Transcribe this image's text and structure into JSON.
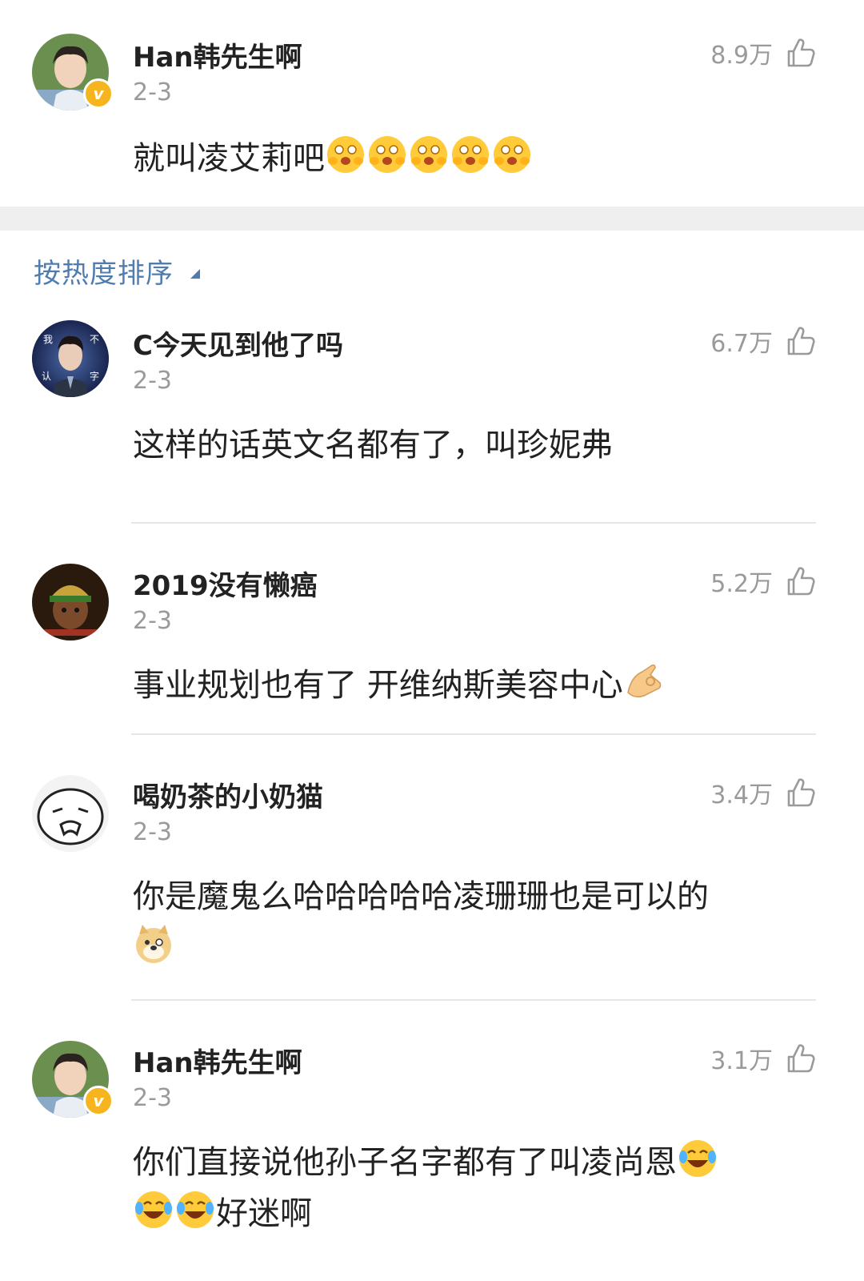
{
  "top_comment": {
    "username": "Han韩先生啊",
    "date": "2-3",
    "likes": "8.9万",
    "text": "就叫凌艾莉吧",
    "verified": true
  },
  "sort": {
    "label": "按热度排序"
  },
  "comments": [
    {
      "username": "C今天见到他了吗",
      "date": "2-3",
      "likes": "6.7万",
      "text": "这样的话英文名都有了，叫珍妮弗"
    },
    {
      "username": "2019没有懒癌",
      "date": "2-3",
      "likes": "5.2万",
      "text": "事业规划也有了 开维纳斯美容中心"
    },
    {
      "username": "喝奶茶的小奶猫",
      "date": "2-3",
      "likes": "3.4万",
      "text": "你是魔鬼么哈哈哈哈哈凌珊珊也是可以的"
    },
    {
      "username": "Han韩先生啊",
      "date": "2-3",
      "likes": "3.1万",
      "text_line1": "你们直接说他孙子名字都有了叫凌尚恩",
      "text_line2": "好迷啊",
      "verified": true
    }
  ],
  "avatar_text": {
    "c1_a": "我",
    "c1_b": "不",
    "c1_c": "认",
    "c1_d": "字"
  },
  "colors": {
    "link_blue": "#507daf",
    "verified_badge": "#f6b51e",
    "separator_gray": "#efefef"
  }
}
